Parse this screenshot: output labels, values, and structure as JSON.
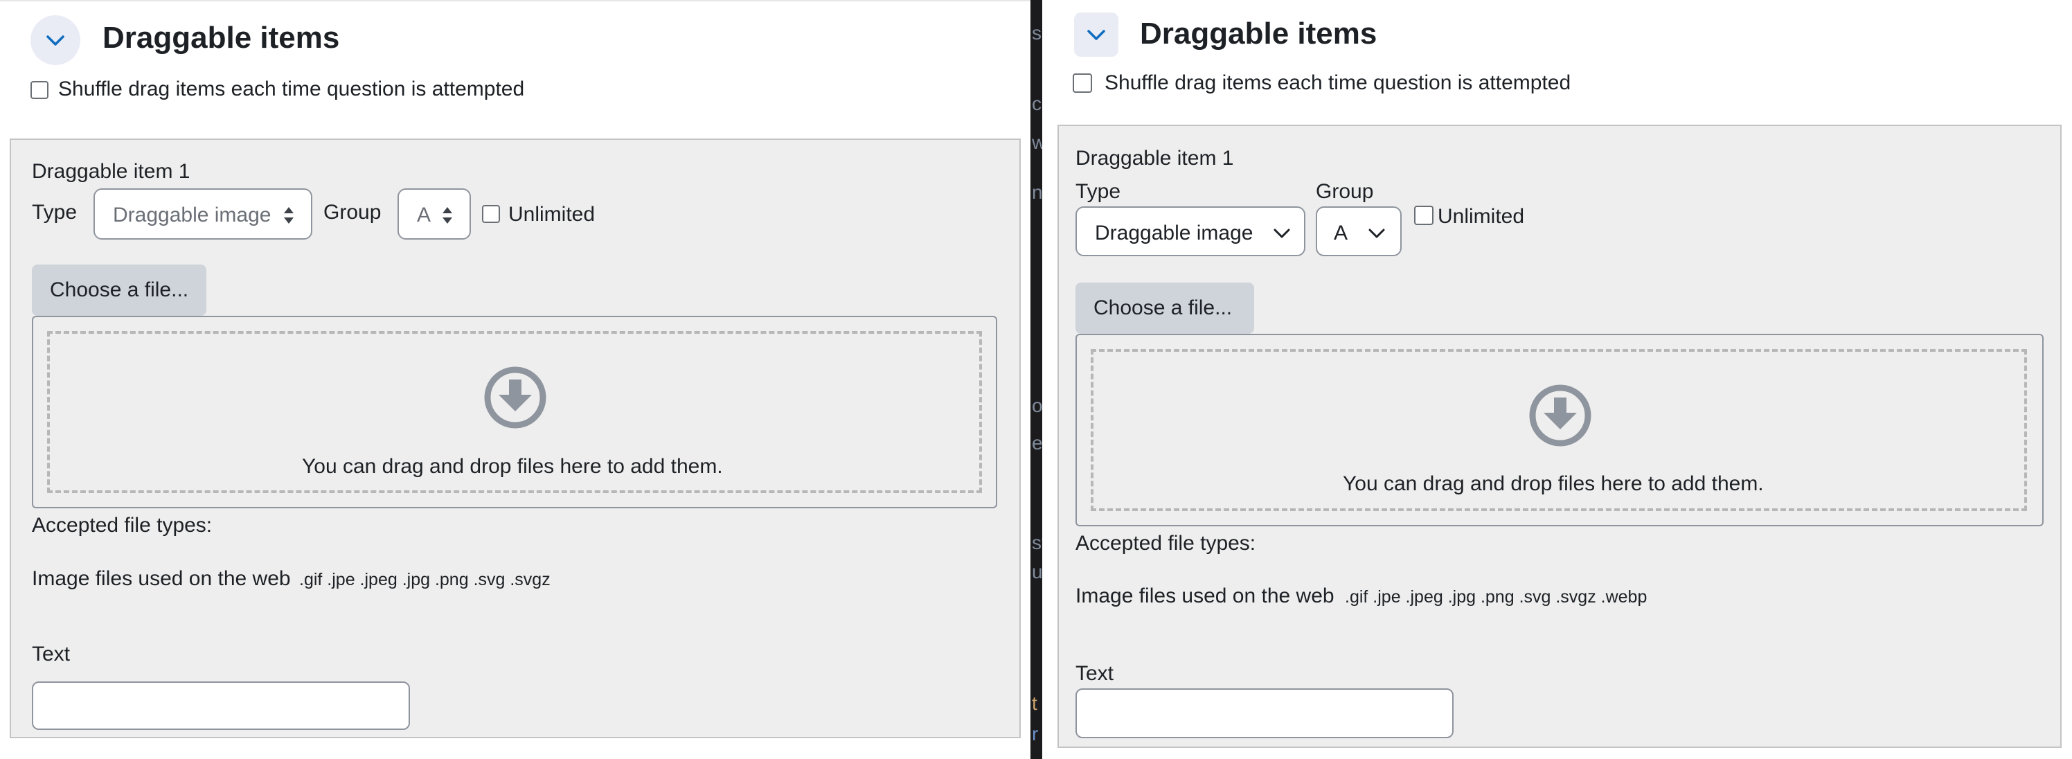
{
  "section": {
    "title": "Draggable items",
    "shuffle_label": "Shuffle drag items each time question is attempted"
  },
  "item": {
    "heading": "Draggable item 1",
    "type_label": "Type",
    "type_value": "Draggable image",
    "group_label": "Group",
    "group_value": "A",
    "unlimited_label": "Unlimited",
    "choose_file_label": "Choose a file...",
    "dropzone_text": "You can drag and drop files here to add them.",
    "accepted_label": "Accepted file types:",
    "filetypes_desc": "Image files used on the web",
    "filetypes_left": ".gif .jpe .jpeg .jpg .png .svg .svgz",
    "filetypes_right": ".gif .jpe .jpeg .jpg .png .svg .svgz .webp",
    "text_label": "Text",
    "text_value": ""
  },
  "icons": {
    "collapse": "chevron-down-icon",
    "select": "sort-arrows-icon",
    "select_new": "chevron-down-icon",
    "dropzone": "download-circle-icon"
  },
  "divider_chars": [
    "s",
    "c",
    "w",
    "n",
    "o",
    "e",
    "st",
    "u",
    "t",
    "r"
  ],
  "colors": {
    "accent": "#0f6cbf",
    "panel_bg": "#eeeeee",
    "button_bg": "#ced4da",
    "icon_gray": "#8f959e"
  }
}
